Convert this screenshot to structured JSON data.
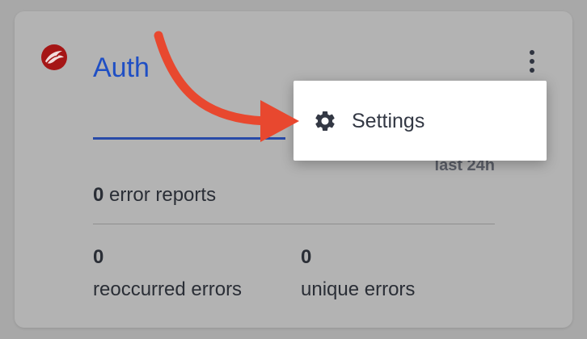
{
  "project": {
    "title": "Auth",
    "logo_icon": "bird-logo-icon",
    "brand_color": "#1f4fc4"
  },
  "summary": {
    "period": "last 24h",
    "error_reports_count": "0",
    "error_reports_label": "error reports"
  },
  "stats": [
    {
      "value": "0",
      "label": "reoccurred errors"
    },
    {
      "value": "0",
      "label": "unique errors"
    }
  ],
  "menu": {
    "items": [
      {
        "label": "Settings",
        "icon": "gear-icon"
      }
    ]
  },
  "annotation": {
    "arrow_color": "#e8482f"
  }
}
